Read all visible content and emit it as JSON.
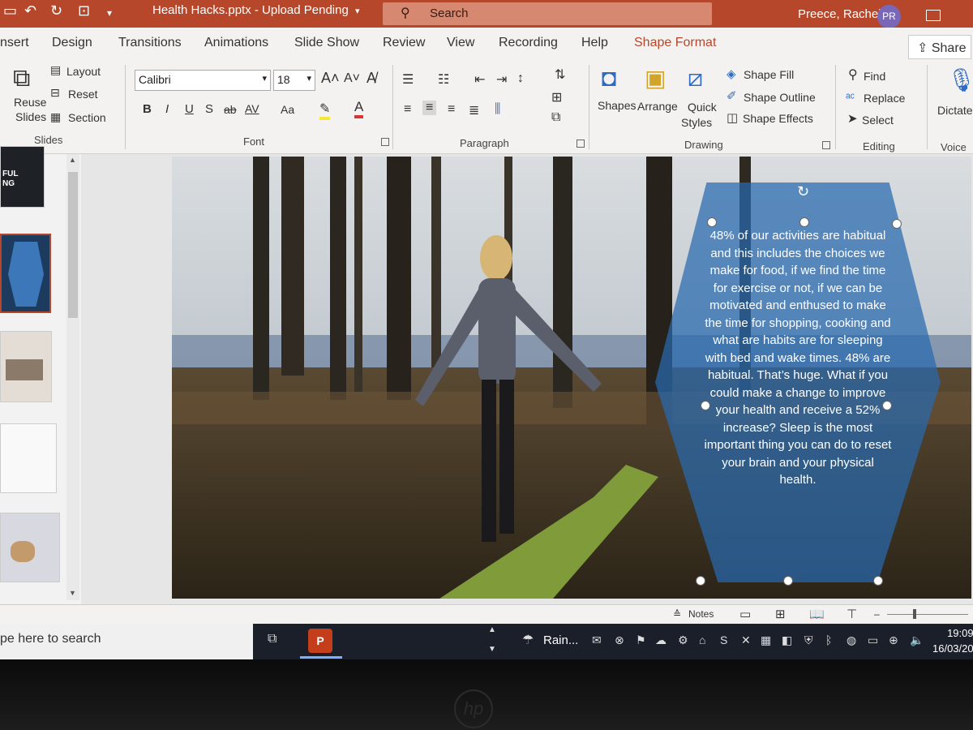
{
  "window": {
    "doc_title": "Health Hacks.pptx  -  Upload Pending",
    "search_placeholder": "Search",
    "user_name": "Preece, Rachel",
    "user_initials": "PR"
  },
  "tabs": [
    "nsert",
    "Design",
    "Transitions",
    "Animations",
    "Slide Show",
    "Review",
    "View",
    "Recording",
    "Help",
    "Shape Format"
  ],
  "active_tab": "Shape Format",
  "share_label": "Share",
  "ribbon": {
    "slides": {
      "reuse_label_1": "Reuse",
      "reuse_label_2": "Slides",
      "layout": "Layout",
      "reset": "Reset",
      "section": "Section",
      "group": "Slides"
    },
    "font": {
      "family": "Calibri",
      "size": "18",
      "group": "Font",
      "bold": "B",
      "italic": "I",
      "underline": "U",
      "shadow": "S",
      "strike": "ab",
      "spacing": "AV",
      "case": "Aa"
    },
    "paragraph": {
      "group": "Paragraph"
    },
    "drawing": {
      "shapes": "Shapes",
      "arrange": "Arrange",
      "quick_1": "Quick",
      "quick_2": "Styles",
      "fill": "Shape Fill",
      "outline": "Shape Outline",
      "effects": "Shape Effects",
      "group": "Drawing"
    },
    "editing": {
      "find": "Find",
      "replace": "Replace",
      "select": "Select",
      "group": "Editing"
    },
    "voice": {
      "dictate": "Dictate",
      "group": "Voice"
    }
  },
  "slide": {
    "hex_text": "48% of our activities are habitual and this includes the choices we make for food, if we find the time for exercise or not, if we can be motivated and enthused to make the time for shopping, cooking and what are habits are for sleeping with bed and wake times.  48% are habitual.  That’s huge.  What if you could make a change to improve your health and receive a 52% increase? Sleep is the most important thing you can do to reset your brain and your physical health."
  },
  "thumbs": {
    "first_title_1": "FUL",
    "first_title_2": "NG"
  },
  "statusbar": {
    "notes": "Notes"
  },
  "taskbar": {
    "search": "pe here to search",
    "weather": "Rain...",
    "time": "19:09",
    "date": "16/03/20"
  },
  "colors": {
    "accent": "#b7472a",
    "hex_fill": "#2869af",
    "ribbon_bg": "#f3f2f1"
  }
}
